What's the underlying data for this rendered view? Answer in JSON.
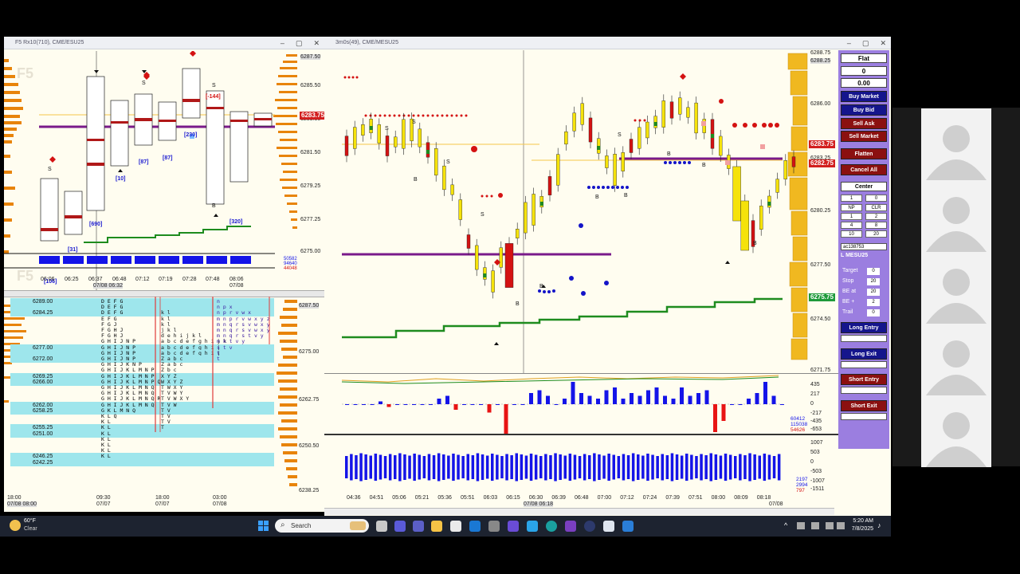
{
  "left_window": {
    "title": "F5 Rx10(710), CME/ESU25",
    "watermark": "F5",
    "watermark_bottom": "F5",
    "price_labels": [
      "6287.50",
      "6285.50",
      "6283.50",
      "6281.50",
      "6279.25",
      "6277.25",
      "6275.00"
    ],
    "last_price": "6283.75",
    "time_labels": [
      "06:06",
      "06:25",
      "06:37",
      "06:48",
      "07:12",
      "07:19",
      "07:28",
      "07:48",
      "08:06"
    ],
    "date_label": "07/08 06:32",
    "date_label2": "07/08",
    "annotations": [
      "[106]",
      "[31]",
      "[690]",
      "[10]",
      "[87]",
      "[87]",
      "[230]",
      "[-144]",
      "[320]"
    ],
    "vol_labels": [
      "50582",
      "94640",
      "44048"
    ],
    "tpo_prices_right": [
      "6287.50",
      "6275.00",
      "6262.75",
      "6250.50",
      "6238.25"
    ],
    "tpo_rows": [
      {
        "price": "6289.00",
        "hl": true,
        "a": "D E F G",
        "b": "",
        "c": "n"
      },
      {
        "price": "",
        "hl": true,
        "a": "D E F G",
        "b": "",
        "c": "n p x"
      },
      {
        "price": "6284.25",
        "hl": true,
        "a": "D E F G",
        "b": "k l",
        "c": "n p r v w x"
      },
      {
        "price": "",
        "hl": false,
        "a": "E F G",
        "b": "k l",
        "c": "m n p r v w x y z"
      },
      {
        "price": "",
        "hl": false,
        "a": "F G J",
        "b": "k l",
        "c": "m n q r s v w x y"
      },
      {
        "price": "",
        "hl": false,
        "a": "F G H J",
        "b": "j k l",
        "c": "m n q r s v w x y"
      },
      {
        "price": "",
        "hl": false,
        "a": "F G H J",
        "b": "d e h i j k l",
        "c": "m n q r s t v y"
      },
      {
        "price": "",
        "hl": false,
        "a": "G H I J N P",
        "b": "a b c d e f g h i j k",
        "c": "m k t v y"
      },
      {
        "price": "6277.00",
        "hl": true,
        "a": "G H I J N P",
        "b": "a b c d e f g h i j",
        "c": "s t v"
      },
      {
        "price": "",
        "hl": true,
        "a": "G H I J N P",
        "b": "a b c d e f g h i j",
        "c": "t"
      },
      {
        "price": "6272.00",
        "hl": true,
        "a": "G H I J N P",
        "b": "Z a b c",
        "c": "t"
      },
      {
        "price": "",
        "hl": false,
        "a": "G H I J K N P",
        "b": "Z a b c",
        "c": ""
      },
      {
        "price": "",
        "hl": false,
        "a": "G H I J K L M N P",
        "b": "Z b c",
        "c": ""
      },
      {
        "price": "6269.25",
        "hl": true,
        "a": "G H I J K L M N P",
        "b": "X Y Z",
        "c": ""
      },
      {
        "price": "6266.00",
        "hl": true,
        "a": "G H I J K L M N P Q",
        "b": "W X Y Z",
        "c": ""
      },
      {
        "price": "",
        "hl": false,
        "a": "G H I J K L M N Q",
        "b": "T W X Y",
        "c": ""
      },
      {
        "price": "",
        "hl": false,
        "a": "G H I J K L M N Q",
        "b": "T V W Y",
        "c": ""
      },
      {
        "price": "",
        "hl": false,
        "a": "G H I J K L M N Q R",
        "b": "T V W X Y",
        "c": ""
      },
      {
        "price": "6262.00",
        "hl": true,
        "a": "G H I J K L M N Q",
        "b": "T V W",
        "c": ""
      },
      {
        "price": "6258.25",
        "hl": true,
        "a": "G K L M N Q",
        "b": "T V",
        "c": ""
      },
      {
        "price": "",
        "hl": false,
        "a": "K L Q",
        "b": "T V",
        "c": ""
      },
      {
        "price": "",
        "hl": false,
        "a": "K L",
        "b": "T V",
        "c": ""
      },
      {
        "price": "6255.25",
        "hl": true,
        "a": "K L",
        "b": "T",
        "c": ""
      },
      {
        "price": "6251.00",
        "hl": true,
        "a": "K L",
        "b": "",
        "c": ""
      },
      {
        "price": "",
        "hl": false,
        "a": "K L",
        "b": "",
        "c": ""
      },
      {
        "price": "",
        "hl": false,
        "a": "K L",
        "b": "",
        "c": ""
      },
      {
        "price": "",
        "hl": false,
        "a": "K L",
        "b": "",
        "c": ""
      },
      {
        "price": "6246.25",
        "hl": true,
        "a": "K L",
        "b": "",
        "c": ""
      },
      {
        "price": "6242.25",
        "hl": true,
        "a": "",
        "b": "",
        "c": ""
      }
    ],
    "bottom_dates": [
      "18:00",
      "09:30",
      "18:00",
      "03:00"
    ],
    "bottom_dates2": [
      "07/08 08:00",
      "07/07",
      "07/07",
      "07/08"
    ]
  },
  "right_window": {
    "title": "3m0s(49), CME/MESU25",
    "price_labels": [
      "6288.75",
      "6286.00",
      "6283.25",
      "6280.25",
      "6277.50",
      "6274.50",
      "6271.75"
    ],
    "top_label": "6288.25",
    "last_price": "6283.75",
    "price_2": "6282.75",
    "green_price": "6275.75",
    "delta_labels": [
      "435",
      "217",
      "0",
      "-217",
      "-435",
      "-653"
    ],
    "delta_side": [
      "60412",
      "115038",
      "54626"
    ],
    "vol_labels": [
      "1007",
      "503",
      "0",
      "-503",
      "-1007",
      "-1511"
    ],
    "vol_side": [
      "2197",
      "2994",
      "797"
    ],
    "time_labels": [
      "04:36",
      "04:51",
      "05:06",
      "05:21",
      "05:36",
      "05:51",
      "06:03",
      "06:15",
      "06:30",
      "06:39",
      "06:48",
      "07:00",
      "07:12",
      "07:24",
      "07:39",
      "07:51",
      "08:00",
      "08:09",
      "08:18"
    ],
    "date_label": "07/08 06:18",
    "date_label_end": "07/08"
  },
  "order_panel": {
    "position": "Flat",
    "qty": "0",
    "pnl": "0.00",
    "buy_market": "Buy Market",
    "buy_bid": "Buy Bid",
    "sell_ask": "Sell Ask",
    "sell_market": "Sell Market",
    "flatten": "Flatten",
    "cancel_all": "Cancel All",
    "center": "Center",
    "qty_field": "1",
    "qty_field2": "0",
    "grid": [
      "NP",
      "CLR",
      "1",
      "2",
      "4",
      "8",
      "10",
      "20"
    ],
    "account": "ac138753",
    "symbol": "L MESU25",
    "target_label": "Target",
    "target_val": "0",
    "stop_label": "Stop",
    "stop_val": "20",
    "beat_label": "BE at",
    "beat_val": "20",
    "beplus_label": "BE +",
    "beplus_val": "2",
    "trail_label": "Trail",
    "trail_val": "0",
    "long_entry": "Long Entry",
    "long_exit": "Long Exit",
    "short_entry": "Short Entry",
    "short_exit": "Short Exit"
  },
  "taskbar": {
    "weather_temp": "60°F",
    "weather_desc": "Clear",
    "search_placeholder": "Search",
    "time": "5:20 AM",
    "date": "7/8/2025"
  }
}
